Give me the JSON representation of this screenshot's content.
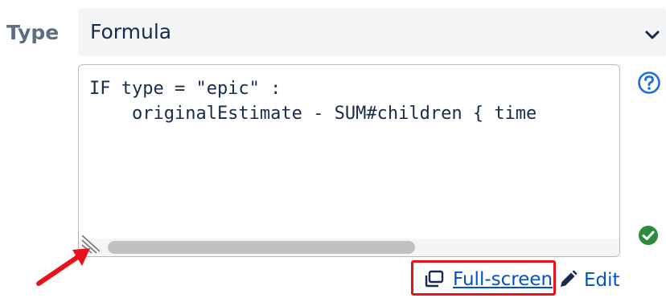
{
  "type_field": {
    "label": "Type",
    "selected_value": "Formula"
  },
  "editor": {
    "code_lines": [
      "IF type = \"epic\" :",
      "    originalEstimate - SUM#children { time"
    ],
    "status": "valid"
  },
  "actions": {
    "fullscreen_label": "Full-screen",
    "edit_label": "Edit"
  },
  "colors": {
    "link": "#0052cc",
    "label": "#5e6c84",
    "help": "#1d6fd6",
    "valid": "#2e8b3d",
    "highlight": "#e8121a",
    "select_bg": "#f4f5f7"
  },
  "icons": {
    "dropdown": "chevron-down-icon",
    "help": "question-circle-icon",
    "valid": "check-circle-icon",
    "fullscreen": "window-restore-icon",
    "edit": "pencil-icon",
    "resize": "resize-grip-icon",
    "annotation": "arrow-annotation-icon"
  }
}
